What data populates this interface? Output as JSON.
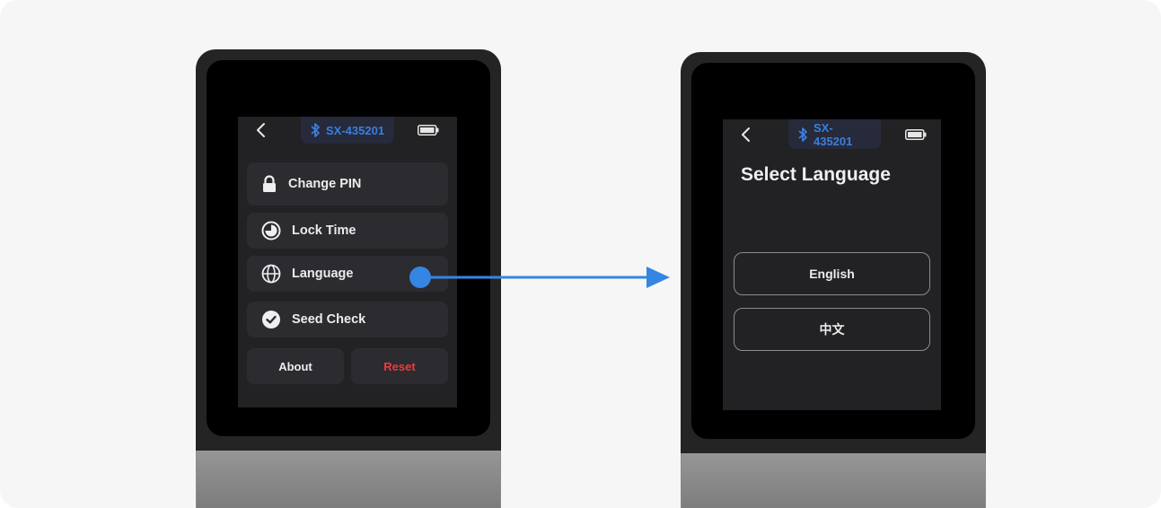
{
  "accent_color": "#3586e2",
  "danger_color": "#ec3b3b",
  "left_screen": {
    "statusbar": {
      "back_icon": "chevron-left-icon",
      "bluetooth_icon": "bluetooth-icon",
      "device_name": "SX-435201",
      "battery_icon": "battery-full-icon"
    },
    "menu": [
      {
        "icon": "lock-icon",
        "label": "Change PIN"
      },
      {
        "icon": "clock-pie-icon",
        "label": "Lock Time"
      },
      {
        "icon": "globe-icon",
        "label": "Language"
      },
      {
        "icon": "check-circle-icon",
        "label": "Seed Check"
      }
    ],
    "about_label": "About",
    "reset_label": "Reset"
  },
  "transition": {
    "from": "Language",
    "indicator": "tap-point-with-arrow"
  },
  "right_screen": {
    "statusbar": {
      "back_icon": "chevron-left-icon",
      "bluetooth_icon": "bluetooth-icon",
      "device_name": "SX-435201",
      "battery_icon": "battery-full-icon"
    },
    "title": "Select Language",
    "options": [
      {
        "label": "English"
      },
      {
        "label": "中文"
      }
    ]
  }
}
